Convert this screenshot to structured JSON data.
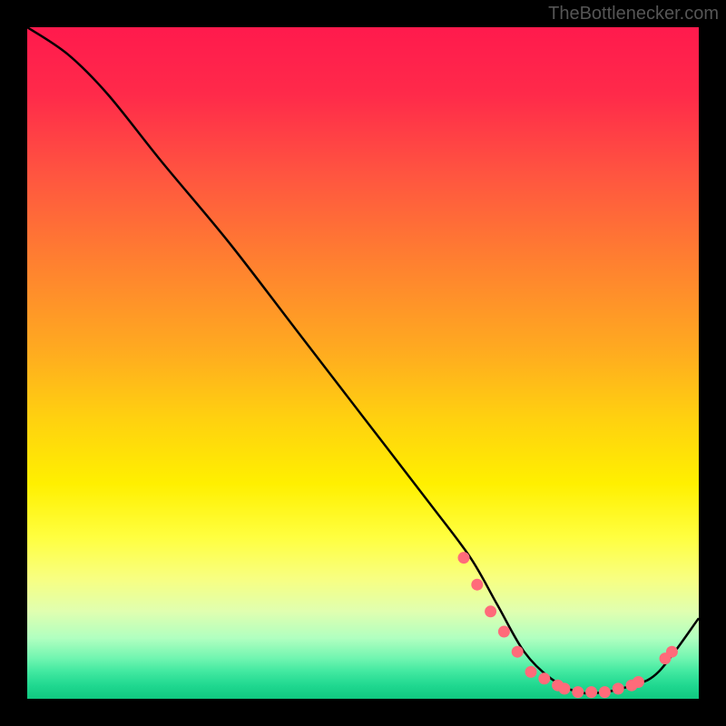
{
  "watermark": "TheBottlenecker.com",
  "chart_data": {
    "type": "line",
    "title": "",
    "xlabel": "",
    "ylabel": "",
    "xlim": [
      0,
      100
    ],
    "ylim": [
      0,
      100
    ],
    "series": [
      {
        "name": "curve",
        "x": [
          0,
          6,
          12,
          20,
          30,
          40,
          50,
          60,
          66,
          70,
          74,
          78,
          82,
          86,
          90,
          94,
          100
        ],
        "y": [
          100,
          96,
          90,
          80,
          68,
          55,
          42,
          29,
          21,
          14,
          7,
          3,
          1,
          1,
          2,
          4,
          12
        ]
      }
    ],
    "markers": {
      "name": "dots",
      "color": "#ff6b7a",
      "points": [
        {
          "x": 65,
          "y": 21
        },
        {
          "x": 67,
          "y": 17
        },
        {
          "x": 69,
          "y": 13
        },
        {
          "x": 71,
          "y": 10
        },
        {
          "x": 73,
          "y": 7
        },
        {
          "x": 75,
          "y": 4
        },
        {
          "x": 77,
          "y": 3
        },
        {
          "x": 79,
          "y": 2
        },
        {
          "x": 80,
          "y": 1.5
        },
        {
          "x": 82,
          "y": 1
        },
        {
          "x": 84,
          "y": 1
        },
        {
          "x": 86,
          "y": 1
        },
        {
          "x": 88,
          "y": 1.5
        },
        {
          "x": 90,
          "y": 2
        },
        {
          "x": 91,
          "y": 2.5
        },
        {
          "x": 95,
          "y": 6
        },
        {
          "x": 96,
          "y": 7
        }
      ]
    }
  }
}
